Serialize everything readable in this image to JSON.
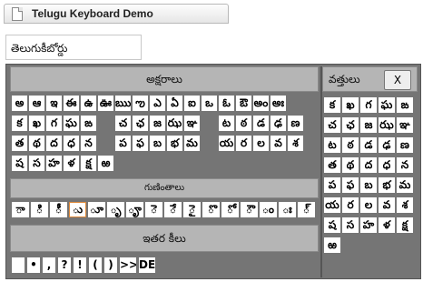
{
  "tab": {
    "title": "Telugu Keyboard Demo",
    "icon": "page-icon"
  },
  "input": {
    "value": "తెలుగుకీబోర్డు"
  },
  "keyboard": {
    "vowels_title": "అక్షరాలు",
    "matras_title": "గుణింతాలు",
    "other_title": "ఇతర కీలు",
    "vowel_rows": [
      [
        "అ",
        "ఆ",
        "ఇ",
        "ఈ",
        "ఉ",
        "ఊ",
        "ఋ",
        "ఌ",
        "ఎ",
        "ఏ",
        "ఐ",
        "ఒ",
        "ఓ",
        "ఔ",
        "అం",
        "అః"
      ],
      [
        "క",
        "ఖ",
        "గ",
        "ఘ",
        "ఙ",
        "",
        "చ",
        "ఛ",
        "జ",
        "ఝ",
        "ఞ",
        "",
        "ట",
        "ఠ",
        "డ",
        "ఢ",
        "ణ"
      ],
      [
        "త",
        "థ",
        "ద",
        "ధ",
        "న",
        "",
        "ప",
        "ఫ",
        "బ",
        "భ",
        "మ",
        "",
        "య",
        "ర",
        "ల",
        "వ",
        "శ"
      ],
      [
        "ష",
        "స",
        "హ",
        "ళ",
        "క్ష",
        "ఱ"
      ]
    ],
    "matras": [
      "ా",
      "ి",
      "ీ",
      "ు",
      "ూ",
      "ృ",
      "ౄ",
      "ె",
      "ే",
      "ై",
      "ొ",
      "ో",
      "ౌ",
      "ం",
      "ః",
      "్"
    ],
    "others": [
      "",
      "•",
      ",",
      "?",
      "!",
      "(",
      ")",
      ">>",
      "DEL"
    ],
    "side": {
      "title": "వత్తులు",
      "close_label": "X",
      "rows": [
        [
          "క",
          "ఖ",
          "గ",
          "ఘ",
          "ఙ"
        ],
        [
          "చ",
          "ఛ",
          "జ",
          "ఝ",
          "ఞ"
        ],
        [
          "ట",
          "ఠ",
          "డ",
          "ఢ",
          "ణ"
        ],
        [
          "త",
          "థ",
          "ద",
          "ధ",
          "న"
        ],
        [
          "ప",
          "ఫ",
          "బ",
          "భ",
          "మ"
        ],
        [
          "య",
          "ర",
          "ల",
          "వ",
          "శ"
        ],
        [
          "ష",
          "స",
          "హ",
          "ళ",
          "క్ష"
        ],
        [
          "ఱ"
        ]
      ]
    }
  }
}
